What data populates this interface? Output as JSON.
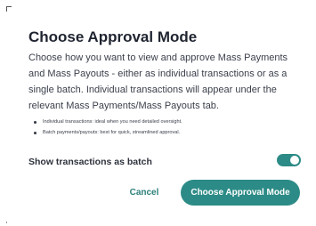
{
  "dialog": {
    "title": "Choose Approval Mode",
    "description": "Choose how you want to view and approve Mass Payments and Mass Payouts - either as individual transactions or as a single batch. Individual transactions will appear under the relevant Mass Payments/Mass Payouts tab.",
    "bullets": [
      "Individual transactions: ideal when you need detailed oversight.",
      "Batch payments/payouts: best for quick, streamlined approval."
    ],
    "toggle": {
      "label": "Show transactions as batch",
      "checked": true
    },
    "buttons": {
      "cancel": "Cancel",
      "confirm": "Choose Approval Mode"
    }
  },
  "colors": {
    "accent": "#2c8b86",
    "title": "#1f2430",
    "body_text": "#3b404b",
    "background": "#ffffff"
  }
}
